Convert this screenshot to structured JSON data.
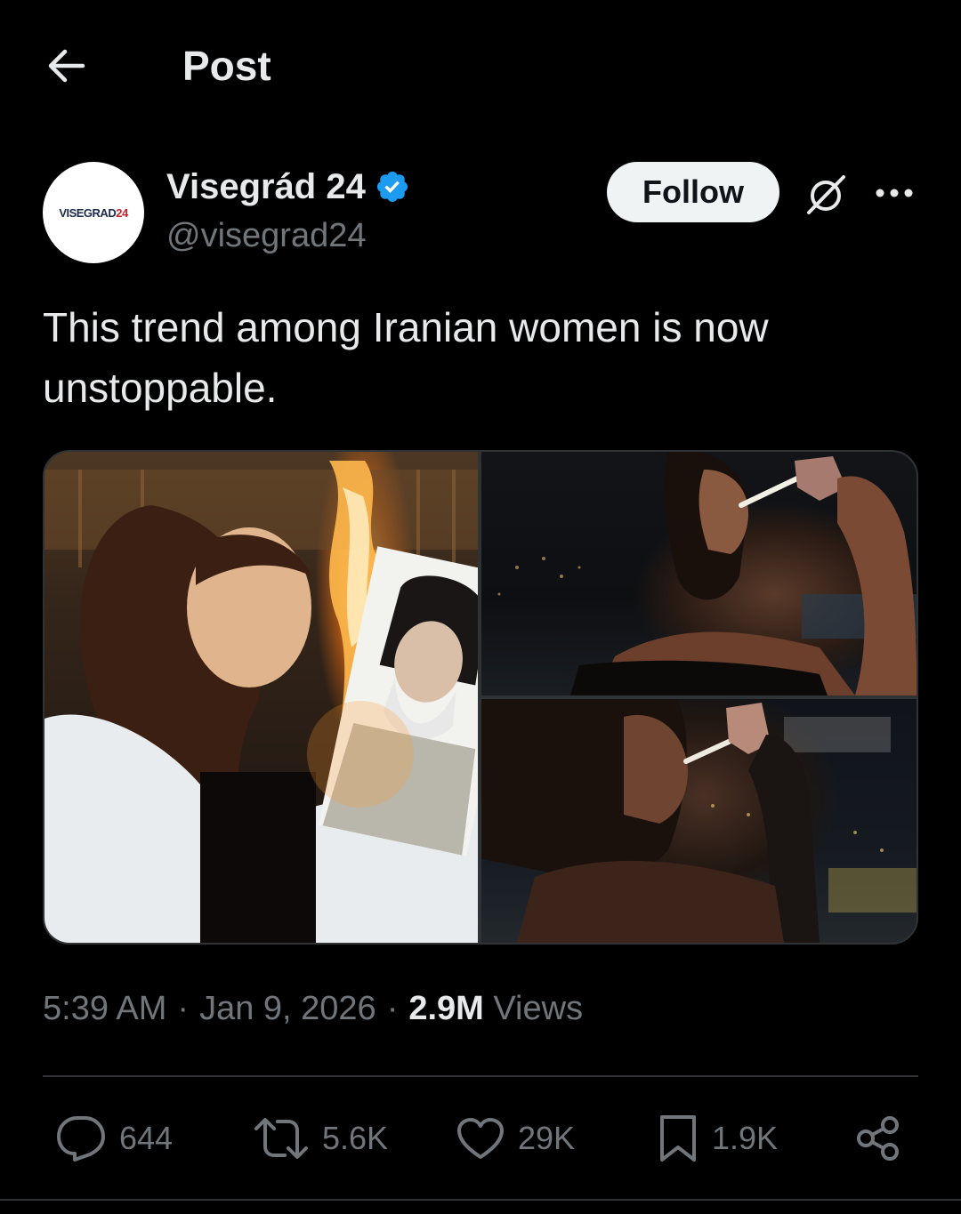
{
  "header": {
    "back_icon": "arrow-left-icon",
    "title": "Post"
  },
  "author": {
    "avatar_text": "VISEGRAD",
    "avatar_text_accent": "24",
    "display_name": "Visegrád 24",
    "verified_icon": "verified-badge-icon",
    "verified_color": "#1d9bf0",
    "handle": "@visegrad24"
  },
  "follow_button": {
    "label": "Follow"
  },
  "grok_icon": "grok-icon",
  "more_icon": "more-horizontal-icon",
  "post": {
    "text": "This trend among Iranian women is now unstoppable.",
    "media_count": 3
  },
  "meta": {
    "time": "5:39 AM",
    "separator": "·",
    "date": "Jan 9, 2026",
    "views_count": "2.9M",
    "views_label": "Views"
  },
  "actions": {
    "reply": {
      "icon": "reply-icon",
      "count": "644"
    },
    "repost": {
      "icon": "repost-icon",
      "count": "5.6K"
    },
    "like": {
      "icon": "heart-icon",
      "count": "29K"
    },
    "bookmark": {
      "icon": "bookmark-icon",
      "count": "1.9K"
    },
    "share": {
      "icon": "share-icon"
    }
  }
}
